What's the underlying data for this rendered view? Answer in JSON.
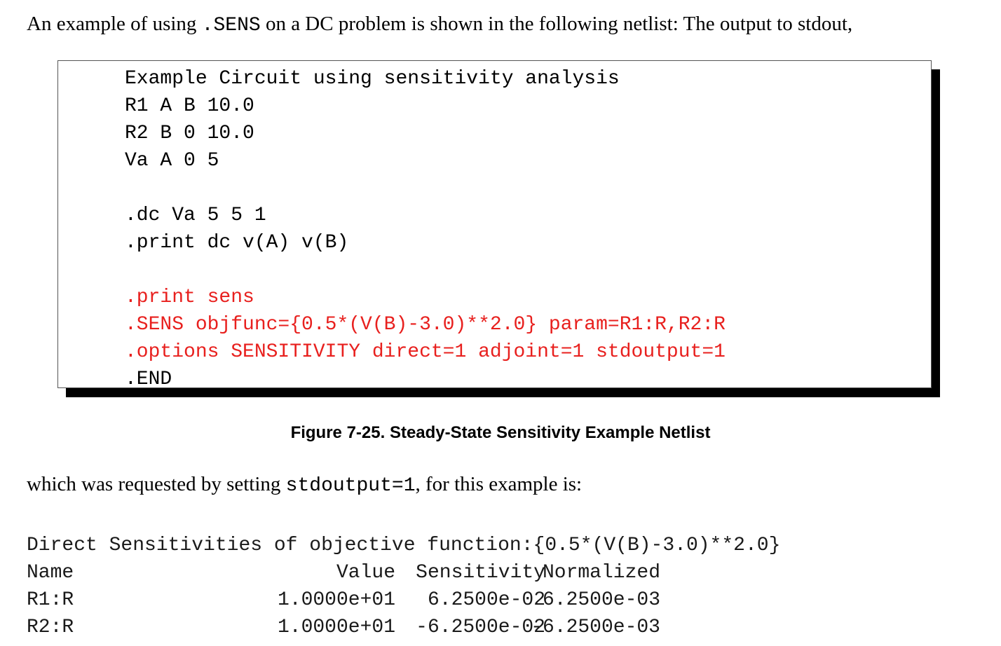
{
  "intro": {
    "before": "An example of using ",
    "code": ".SENS",
    "after": " on a DC problem is shown in the following netlist: The output to stdout,"
  },
  "netlist": {
    "lines": [
      {
        "text": "Example Circuit using sensitivity analysis",
        "highlight": false
      },
      {
        "text": "R1 A B 10.0",
        "highlight": false
      },
      {
        "text": "R2 B 0 10.0",
        "highlight": false
      },
      {
        "text": "Va A 0 5",
        "highlight": false
      },
      {
        "text": "",
        "highlight": false
      },
      {
        "text": ".dc Va 5 5 1",
        "highlight": false
      },
      {
        "text": ".print dc v(A) v(B)",
        "highlight": false
      },
      {
        "text": "",
        "highlight": false
      },
      {
        "text": ".print sens",
        "highlight": true
      },
      {
        "text": ".SENS objfunc={0.5*(V(B)-3.0)**2.0} param=R1:R,R2:R",
        "highlight": true
      },
      {
        "text": ".options SENSITIVITY direct=1 adjoint=1 stdoutput=1",
        "highlight": true
      },
      {
        "text": ".END",
        "highlight": false
      }
    ],
    "highlight_color": "#e8201e"
  },
  "caption": "Figure 7-25. Steady-State Sensitivity Example Netlist",
  "followup": {
    "before": "which was requested by setting ",
    "code": "stdoutput=1",
    "after": ", for this example is:"
  },
  "output": {
    "header": "Direct Sensitivities of objective function:{0.5*(V(B)-3.0)**2.0}",
    "columns": {
      "name": "Name",
      "value": "Value",
      "sensitivity": "Sensitivity",
      "normalized": "Normalized"
    },
    "rows": [
      {
        "name": "R1:R",
        "value": "1.0000e+01",
        "sensitivity": "6.2500e-02",
        "normalized": "6.2500e-03"
      },
      {
        "name": "R2:R",
        "value": "1.0000e+01",
        "sensitivity": "-6.2500e-02",
        "normalized": "-6.2500e-03"
      }
    ]
  }
}
